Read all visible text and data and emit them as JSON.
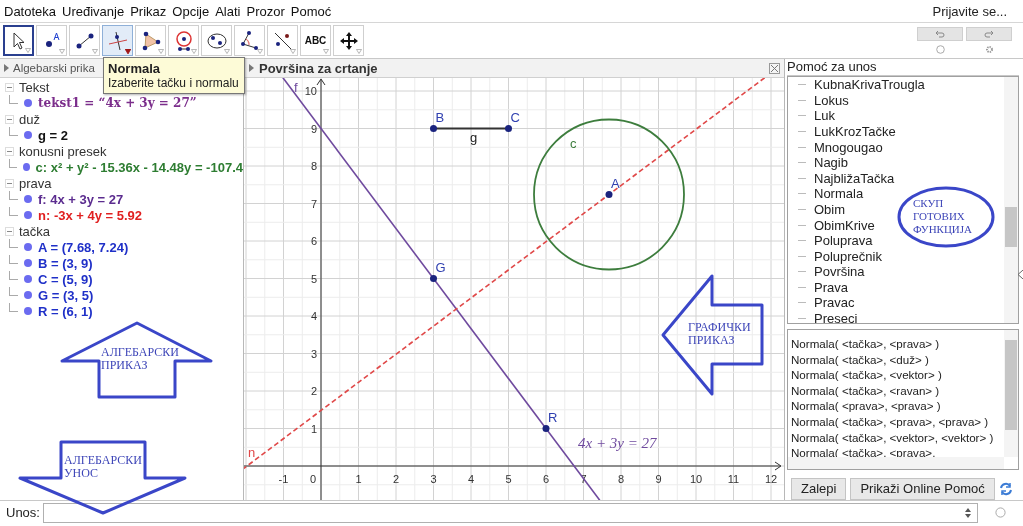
{
  "menu": [
    "Datoteka",
    "Uređivanje",
    "Prikaz",
    "Opcije",
    "Alati",
    "Prozor",
    "Pomoć"
  ],
  "account": "Prijavite se...",
  "tools": [
    {
      "kind": "pointer",
      "selected": true,
      "hovered": false
    },
    {
      "kind": "point",
      "selected": false,
      "hovered": false
    },
    {
      "kind": "segment",
      "selected": false,
      "hovered": false
    },
    {
      "kind": "perpendicular",
      "selected": false,
      "hovered": true
    },
    {
      "kind": "polygon",
      "selected": false,
      "hovered": false
    },
    {
      "kind": "circle",
      "selected": false,
      "hovered": false
    },
    {
      "kind": "conic",
      "selected": false,
      "hovered": false
    },
    {
      "kind": "angle",
      "selected": false,
      "hovered": false
    },
    {
      "kind": "reflect",
      "selected": false,
      "hovered": false
    },
    {
      "kind": "text",
      "label": "ABC",
      "selected": false,
      "hovered": false
    },
    {
      "kind": "move",
      "selected": false,
      "hovered": false
    }
  ],
  "tooltip": {
    "title": "Normala",
    "text": "Izaberite tačku i normalu"
  },
  "algebra": {
    "title": "Algebarski prika",
    "groups": [
      {
        "label": "Tekst",
        "expanded": true,
        "items": [
          {
            "kind": "text",
            "text": "tekst1 = “4x + 3y = 27”",
            "color": "#7b2d8b"
          }
        ]
      },
      {
        "label": "duž",
        "expanded": true,
        "items": [
          {
            "kind": "object",
            "text": "g = 2",
            "color": "#111111"
          }
        ]
      },
      {
        "label": "konusni presek",
        "expanded": true,
        "items": [
          {
            "kind": "object",
            "text": "c: x² + y² - 15.36x - 14.48y = -107.4",
            "color": "#2e7d32"
          }
        ]
      },
      {
        "label": "prava",
        "expanded": true,
        "items": [
          {
            "kind": "object",
            "text": "f: 4x + 3y = 27",
            "color": "#5b2c8f"
          },
          {
            "kind": "object",
            "text": "n: -3x + 4y = 5.92",
            "color": "#e02020"
          }
        ]
      },
      {
        "label": "tačka",
        "expanded": true,
        "items": [
          {
            "kind": "object",
            "text": "A = (7.68, 7.24)",
            "color": "#1f30c8"
          },
          {
            "kind": "object",
            "text": "B = (3, 9)",
            "color": "#1f30c8"
          },
          {
            "kind": "object",
            "text": "C = (5, 9)",
            "color": "#1f30c8"
          },
          {
            "kind": "object",
            "text": "G = (3, 5)",
            "color": "#1f30c8"
          },
          {
            "kind": "object",
            "text": "R = (6, 1)",
            "color": "#1f30c8"
          }
        ]
      }
    ]
  },
  "graphics": {
    "title": "Površina za crtanje",
    "x_tick_labels": [
      "-1",
      "0",
      "1",
      "2",
      "3",
      "4",
      "5",
      "6",
      "7",
      "8",
      "9",
      "10",
      "11",
      "12"
    ],
    "y_tick_labels": [
      "10",
      "9",
      "8",
      "7",
      "6",
      "5",
      "4",
      "3",
      "2",
      "1"
    ],
    "objects": [
      {
        "kind": "line",
        "label": "f",
        "color": "#6f4a9e"
      },
      {
        "kind": "dashed-line",
        "label": "n",
        "color": "#e04848"
      },
      {
        "kind": "circle",
        "label": "c",
        "color": "#3d7d3d"
      },
      {
        "kind": "segment",
        "label": "g",
        "color": "#333333"
      },
      {
        "kind": "point",
        "label": "A",
        "color": "#1a237e"
      },
      {
        "kind": "point",
        "label": "B",
        "color": "#1a237e"
      },
      {
        "kind": "point",
        "label": "C",
        "color": "#1a237e"
      },
      {
        "kind": "point",
        "label": "G",
        "color": "#1a237e"
      },
      {
        "kind": "point",
        "label": "R",
        "color": "#1a237e"
      },
      {
        "kind": "text",
        "label": "4x + 3y = 27",
        "color": "#6f4a9e"
      }
    ]
  },
  "input_help": {
    "title": "Pomoć za unos",
    "commands": [
      "KubnaKrivaTrougla",
      "Lokus",
      "Luk",
      "LukKrozTačke",
      "Mnogougao",
      "Nagib",
      "NajbližaTačka",
      "Normala",
      "Obim",
      "ObimKrive",
      "Poluprava",
      "Poluprečnik",
      "Površina",
      "Prava",
      "Pravac",
      "Preseci"
    ],
    "syntax": [
      "Normala( <tačka>, <prava> )",
      "Normala( <tačka>, <duž> )",
      "Normala( <tačka>, <vektor> )",
      "Normala( <tačka>, <ravan> )",
      "Normala( <prava>, <prava> )",
      "Normala( <tačka>, <prava>, <prava> )",
      "Normala( <tačka>, <vektor>, <vektor> )",
      "Normala( <tačka>, <prava>,"
    ],
    "buttons": [
      "Zalepi",
      "Prikaži Online Pomoć"
    ]
  },
  "input_bar": {
    "label": "Unos:"
  },
  "annotations": [
    {
      "kind": "arrow-up",
      "lines": [
        "АЛГЕБАРСКИ",
        "ПРИКАЗ"
      ]
    },
    {
      "kind": "arrow-down",
      "lines": [
        "АЛГЕБАРСКИ",
        "УНОС"
      ]
    },
    {
      "kind": "arrow-left",
      "lines": [
        "ГРАФИЧКИ",
        "ПРИКАЗ"
      ]
    },
    {
      "kind": "ellipse",
      "lines": [
        "СКУП",
        "ГОТОВИХ",
        "ФУНКЦИЈА"
      ]
    }
  ]
}
